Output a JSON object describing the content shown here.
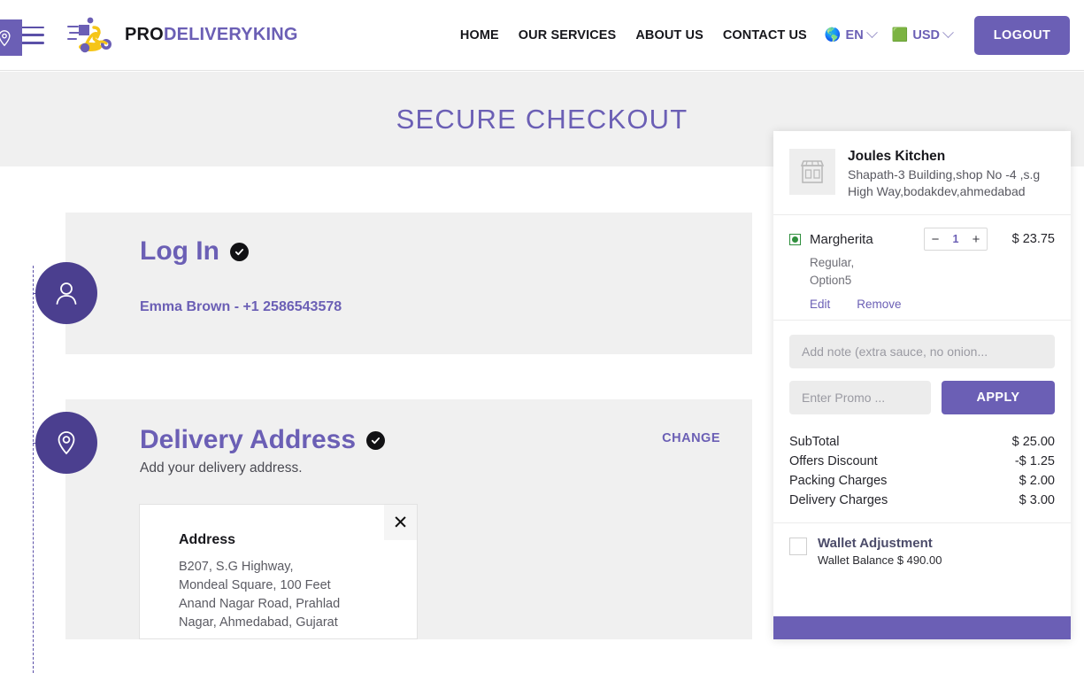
{
  "header": {
    "menu_icon": "hamburger-icon",
    "brand": {
      "part1": "PRO",
      "part2": "DELIVERYKING",
      "logo_icon": "scooter-delivery-logo"
    },
    "nav": [
      {
        "label": "HOME"
      },
      {
        "label": "OUR SERVICES"
      },
      {
        "label": "ABOUT US"
      },
      {
        "label": "CONTACT US"
      }
    ],
    "language": {
      "flag": "🌎",
      "label": "EN"
    },
    "currency": {
      "flag": "🟩",
      "label": "USD"
    },
    "logout_label": "LOGOUT"
  },
  "banner": {
    "title": "SECURE CHECKOUT"
  },
  "steps": {
    "login": {
      "icon": "user-icon",
      "title": "Log In",
      "completed": true,
      "user_line": "Emma Brown - +1 2586543578"
    },
    "address": {
      "icon": "map-pin-icon",
      "title": "Delivery Address",
      "completed": true,
      "sub_note": "Add your delivery address.",
      "change_label": "CHANGE",
      "card": {
        "pin_icon": "map-pin-icon",
        "close_icon": "close-icon",
        "title": "Address",
        "lines": "B207, S.G Highway, Mondeal Square, 100 Feet Anand Nagar Road, Prahlad Nagar, Ahmedabad, Gujarat"
      }
    }
  },
  "cart": {
    "store": {
      "icon": "storefront-icon",
      "name": "Joules Kitchen",
      "address": "Shapath-3 Building,shop No -4 ,s.g High Way,bodakdev,ahmedabad"
    },
    "items": [
      {
        "veg": true,
        "name": "Margherita",
        "qty": "1",
        "price": "$ 23.75",
        "options": "Regular,\nOption5",
        "edit_label": "Edit",
        "remove_label": "Remove",
        "minus_icon": "minus-icon",
        "plus_icon": "plus-icon"
      }
    ],
    "note_placeholder": "Add note (extra sauce, no onion...",
    "note_value": "",
    "promo_placeholder": "Enter Promo ...",
    "promo_value": "",
    "apply_label": "APPLY",
    "totals": [
      {
        "label": "SubTotal",
        "value": "$ 25.00"
      },
      {
        "label": "Offers Discount",
        "value": "-$ 1.25"
      },
      {
        "label": "Packing Charges",
        "value": "$ 2.00"
      },
      {
        "label": "Delivery Charges",
        "value": "$ 3.00"
      }
    ],
    "wallet": {
      "title": "Wallet Adjustment",
      "balance": "Wallet Balance $ 490.00",
      "checked": false
    },
    "cta_label": ""
  },
  "colors": {
    "brand_purple": "#6b5fb5",
    "step_purple": "#4b3f8f",
    "banner_bg": "#f0f0f0",
    "veg_green": "#2f8f3d"
  }
}
